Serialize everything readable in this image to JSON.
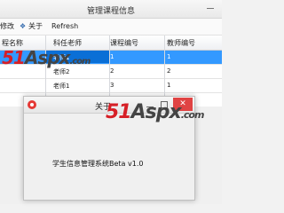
{
  "window": {
    "title": "管理课程信息"
  },
  "toolbar": {
    "edit_label": "修改",
    "about_label": "关于",
    "refresh_label": "Refresh"
  },
  "grid": {
    "columns": [
      "程名称",
      "科任老师",
      "课程编号",
      "教师编号"
    ],
    "rows": [
      {
        "name": "",
        "teacher": "老师1",
        "course_id": "1",
        "teacher_id": "1",
        "selected": true
      },
      {
        "name": "",
        "teacher": "老师2",
        "course_id": "2",
        "teacher_id": "2",
        "selected": false
      },
      {
        "name": "",
        "teacher": "老师1",
        "course_id": "3",
        "teacher_id": "1",
        "selected": false
      }
    ]
  },
  "watermark": {
    "number": "51",
    "brand": "Aspx",
    "suffix": ".com"
  },
  "about_dialog": {
    "title": "关于",
    "close_glyph": "✕",
    "message": "学生信息管理系统Beta v1.0"
  },
  "colors": {
    "selection": "#3399ff",
    "close_button": "#e04343",
    "watermark_red": "#d61f26"
  },
  "icons": {
    "about": "info-icon",
    "app": "app-icon"
  }
}
